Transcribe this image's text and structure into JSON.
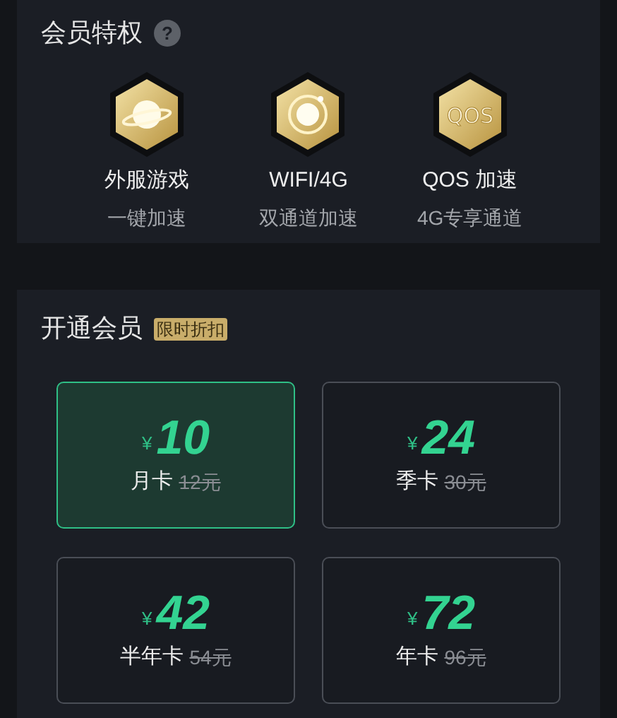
{
  "privileges": {
    "title": "会员特权",
    "help": "?",
    "items": [
      {
        "title": "外服游戏",
        "subtitle": "一键加速"
      },
      {
        "title": "WIFI/4G",
        "subtitle": "双通道加速"
      },
      {
        "title": "QOS 加速",
        "subtitle": "4G专享通道",
        "icon_text": "QOS"
      }
    ]
  },
  "membership": {
    "title": "开通会员",
    "badge": "限时折扣",
    "plans": [
      {
        "currency": "¥",
        "price": "10",
        "name": "月卡",
        "original": "12元",
        "selected": true
      },
      {
        "currency": "¥",
        "price": "24",
        "name": "季卡",
        "original": "30元",
        "selected": false
      },
      {
        "currency": "¥",
        "price": "42",
        "name": "半年卡",
        "original": "54元",
        "selected": false
      },
      {
        "currency": "¥",
        "price": "72",
        "name": "年卡",
        "original": "96元",
        "selected": false
      }
    ]
  }
}
